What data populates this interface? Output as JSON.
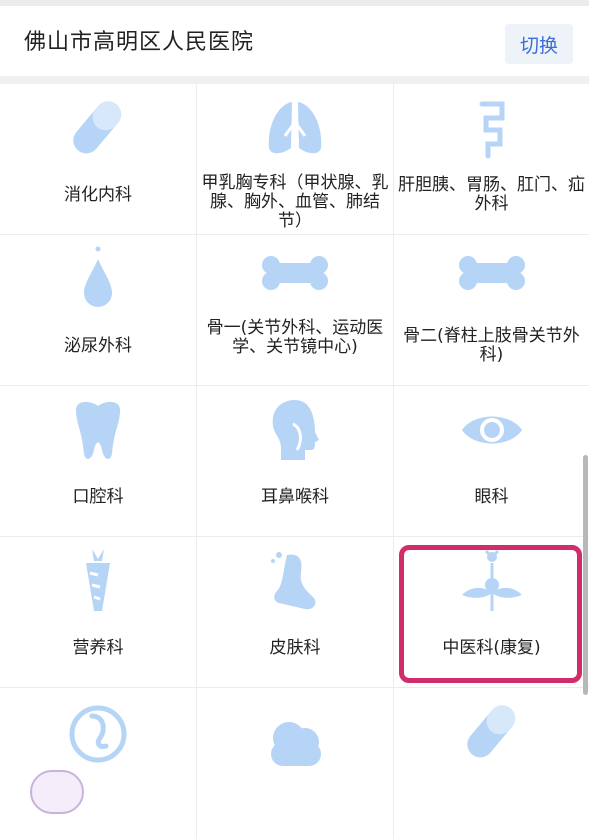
{
  "header": {
    "title": "佛山市高明区人民医院",
    "switch_label": "切换"
  },
  "departments": [
    {
      "label": "消化内科",
      "icon": "capsule-icon"
    },
    {
      "label": "甲乳胸专科（甲状腺、乳腺、胸外、血管、肺结节）",
      "icon": "lungs-icon"
    },
    {
      "label": "肝胆胰、胃肠、肛门、疝外科",
      "icon": "intestine-icon"
    },
    {
      "label": "泌尿外科",
      "icon": "drop-icon"
    },
    {
      "label": "骨一(关节外科、运动医学、关节镜中心)",
      "icon": "bone-icon"
    },
    {
      "label": "骨二(脊柱上肢骨关节外科)",
      "icon": "bone-icon"
    },
    {
      "label": "口腔科",
      "icon": "tooth-icon"
    },
    {
      "label": "耳鼻喉科",
      "icon": "head-profile-icon"
    },
    {
      "label": "眼科",
      "icon": "eye-icon"
    },
    {
      "label": "营养科",
      "icon": "carrot-icon"
    },
    {
      "label": "皮肤科",
      "icon": "foot-icon"
    },
    {
      "label": "中医科(康复)",
      "icon": "herb-icon"
    }
  ],
  "colors": {
    "icon": "#b5d4f6",
    "accent": "#3a6fd8",
    "highlight": "#d12d6a"
  }
}
